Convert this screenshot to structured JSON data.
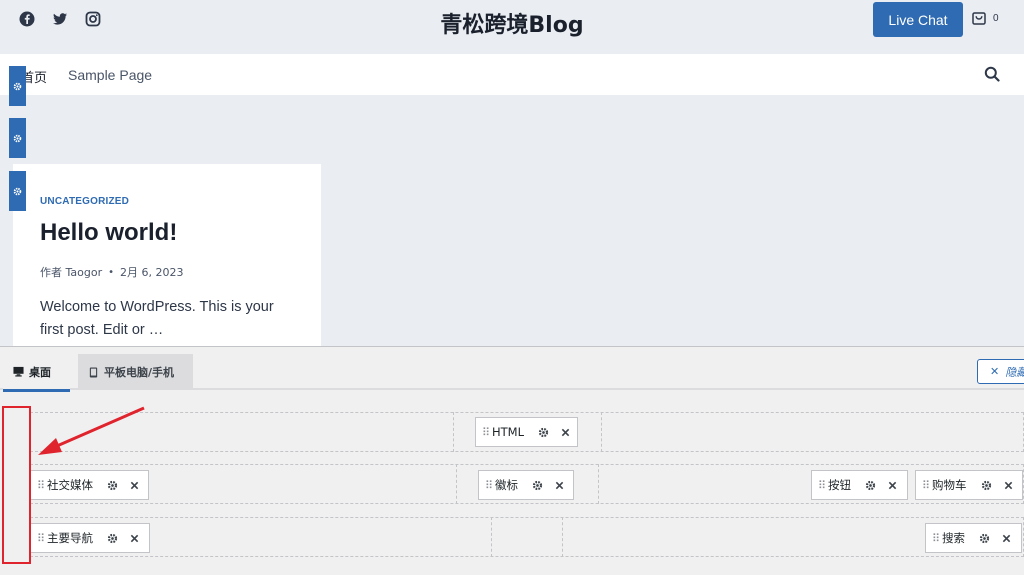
{
  "header": {
    "site_title": "青松跨境Blog",
    "live_chat_label": "Live Chat",
    "cart_count": "0",
    "social_icons": [
      "facebook-icon",
      "twitter-icon",
      "instagram-icon"
    ]
  },
  "nav": {
    "items": [
      "首页",
      "Sample Page"
    ]
  },
  "post": {
    "category": "UNCATEGORIZED",
    "title": "Hello world!",
    "author": "作者 Taogor",
    "separator": "•",
    "date": "2月 6, 2023",
    "excerpt": "Welcome to WordPress. This is your first post. Edit or …"
  },
  "builder": {
    "tabs": [
      "桌面",
      "平板电脑/手机"
    ],
    "hide_label": "隐藏",
    "rows": {
      "top": {
        "center": [
          "HTML"
        ]
      },
      "main": {
        "left": [
          "社交媒体"
        ],
        "center": [
          "徽标"
        ],
        "right": [
          "按钮",
          "购物车"
        ]
      },
      "bottom": {
        "left": [
          "主要导航"
        ],
        "right": [
          "搜索"
        ]
      }
    }
  },
  "colors": {
    "accent": "#2f6bb2",
    "highlight": "#e0242e",
    "header_bg": "#eaeef3"
  }
}
